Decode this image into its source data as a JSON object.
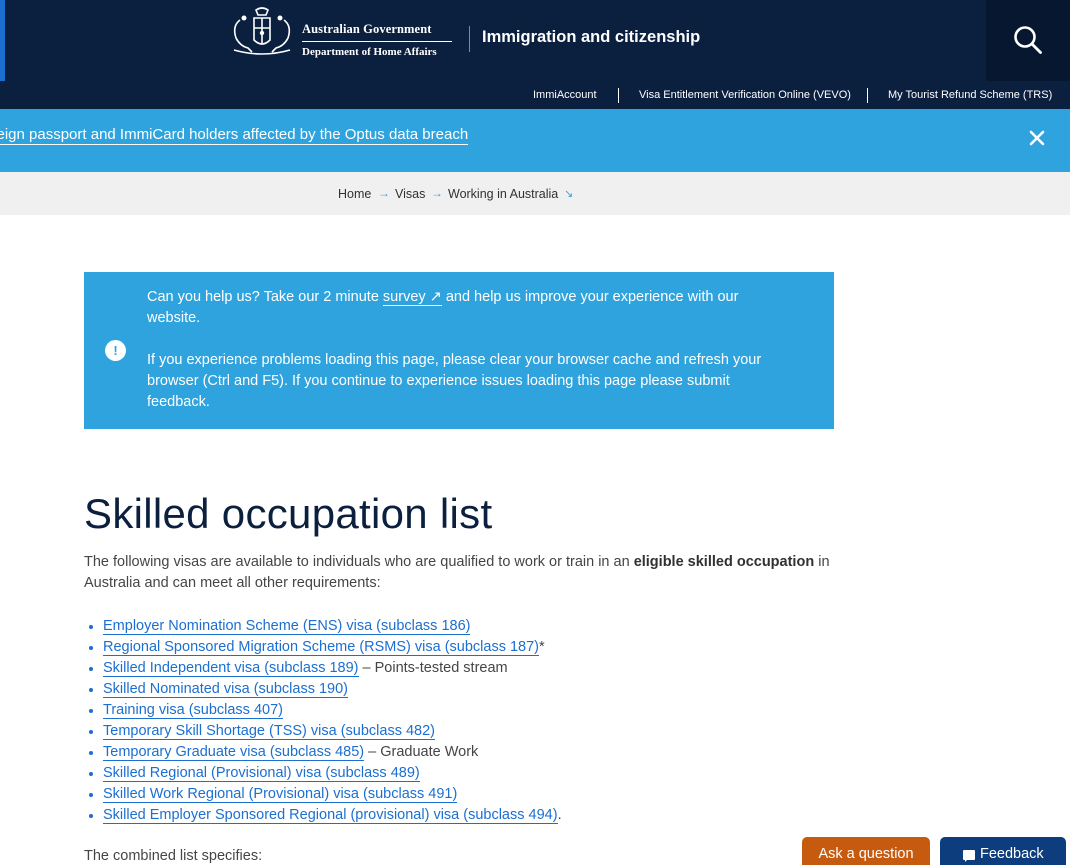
{
  "header": {
    "gov_line1": "Australian Government",
    "gov_line2": "Department of Home Affairs",
    "site_title": "Immigration and citizenship",
    "search_icon": "search-icon"
  },
  "utility_nav": [
    {
      "label": "ImmiAccount"
    },
    {
      "label": "Visa Entitlement Verification Online (VEVO)"
    },
    {
      "label": "My Tourist Refund Scheme (TRS)"
    }
  ],
  "alert": {
    "text": "Foreign passport and ImmiCard holders affected by the Optus data breach",
    "close_icon": "close-icon"
  },
  "breadcrumb": {
    "items": [
      "Home",
      "Visas",
      "Working in Australia"
    ],
    "separator_icon": "arrow-right-icon",
    "expand_icon": "arrow-down-right-icon"
  },
  "info_box": {
    "p1_before": "Can you help us? Take our 2 minute ",
    "p1_link": "survey ↗",
    "p1_after": " and help us improve your experience with our website.",
    "p2": "If you experience problems loading this page, please clear your browser cache and refresh your browser (Ctrl and F5). If you continue to experience issues loading this page please submit feedback.",
    "icon": "info-icon"
  },
  "main": {
    "title": "Skilled occupation list",
    "intro_before": "The following visas are available to individuals who are qualified to work or train in an ",
    "intro_bold": "eligible skilled occupation",
    "intro_after": " in Australia and can meet all other requirements:",
    "visas": [
      {
        "link": "Employer Nomination Scheme (ENS) visa (subclass 186)",
        "suffix": ""
      },
      {
        "link": "Regional Sponsored Migration Scheme (RSMS) visa (subclass 187)",
        "suffix": "*"
      },
      {
        "link": "Skilled Independent visa (subclass 189)",
        "suffix": " – Points-tested stream"
      },
      {
        "link": "Skilled Nominated visa (subclass 190)",
        "suffix": ""
      },
      {
        "link": "Training visa (subclass 407)",
        "suffix": ""
      },
      {
        "link": "Temporary Skill Shortage (TSS) visa (subclass 482)",
        "suffix": ""
      },
      {
        "link": "Temporary Graduate visa (subclass 485)",
        "suffix": " – Graduate Work"
      },
      {
        "link": "Skilled Regional (Provisional) visa (subclass 489)",
        "suffix": ""
      },
      {
        "link": "Skilled Work Regional (Provisional) visa (subclass 491)",
        "suffix": ""
      },
      {
        "link": "Skilled Employer Sponsored Regional (provisional) visa (subclass 494)",
        "suffix": "."
      }
    ],
    "combined": "The combined list specifies:"
  },
  "floating": {
    "ask": "Ask a question",
    "feedback": "Feedback",
    "feedback_icon": "chat-icon"
  },
  "colors": {
    "navy": "#0b1f3f",
    "accent_blue": "#2fa3dd",
    "link_blue": "#1b6fd1",
    "ask_orange": "#c65a0f",
    "feedback_navy": "#0d3d7c"
  }
}
